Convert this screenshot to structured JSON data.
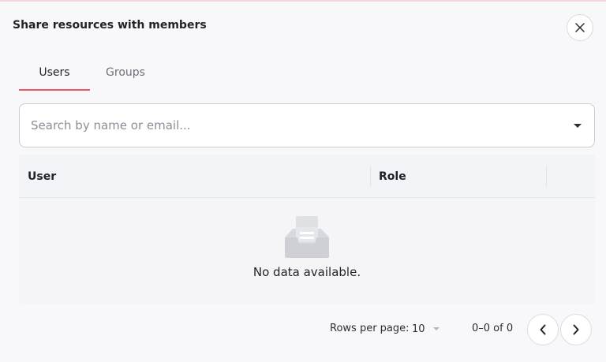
{
  "dialog": {
    "title": "Share resources with members"
  },
  "tabs": [
    {
      "label": "Users",
      "active": true
    },
    {
      "label": "Groups",
      "active": false
    }
  ],
  "search": {
    "placeholder": "Search by name or email..."
  },
  "table": {
    "columns": [
      "User",
      "Role"
    ],
    "empty_message": "No data available."
  },
  "pagination": {
    "rows_per_page_label": "Rows per page:",
    "rows_per_page_value": "10",
    "range": "0–0 of 0"
  },
  "colors": {
    "accent": "#e8566a",
    "border": "#c9ccd2",
    "background": "#f8f8fa"
  },
  "icons": [
    "close-icon",
    "caret-down-icon",
    "inbox-empty-icon",
    "chevron-left-icon",
    "chevron-right-icon"
  ]
}
